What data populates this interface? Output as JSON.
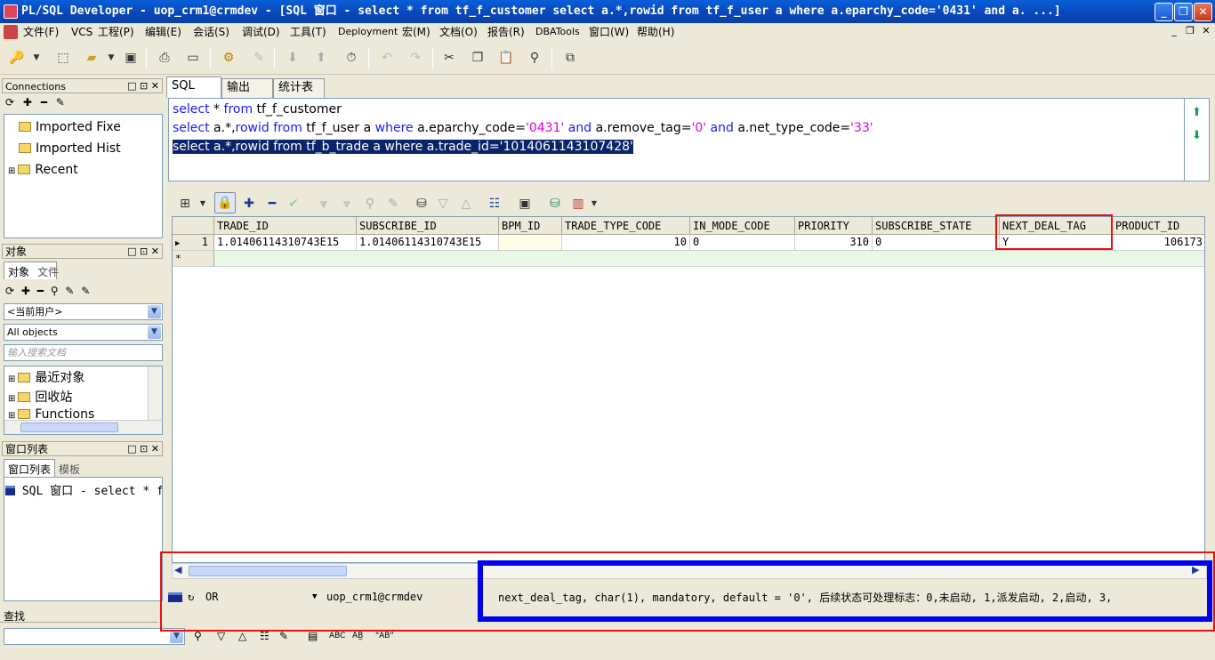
{
  "window": {
    "title": "PL/SQL Developer - uop_crm1@crmdev - [SQL 窗口 - select * from tf_f_customer select a.*,rowid from tf_f_user a where a.eparchy_code='0431' and a. ...]",
    "min": "_",
    "max": "❐",
    "close": "✕"
  },
  "menu": {
    "items": [
      "文件(F)",
      "VCS",
      "工程(P)",
      "编辑(E)",
      "会话(S)",
      "调试(D)",
      "工具(T)",
      "Deployment",
      "宏(M)",
      "文档(O)",
      "报告(R)",
      "DBATools",
      "窗口(W)",
      "帮助(H)"
    ],
    "mdi": [
      "_",
      "❐",
      "✕"
    ]
  },
  "connections": {
    "title": "Connections",
    "toolbar": "⟳ ✚ ━ ✎",
    "items": [
      "Imported Fixe",
      "Imported Hist",
      "Recent"
    ]
  },
  "objects": {
    "title": "对象",
    "tabs": [
      "对象",
      "文件"
    ],
    "toolbar": "⟳ ✚ ━ ⚲ ✎ ✎",
    "user_combo": "<当前用户>",
    "type_combo": "All objects",
    "search_placeholder": "输入搜索文档",
    "tree": [
      "最近对象",
      "回收站",
      "Functions"
    ]
  },
  "windowlist": {
    "title": "窗口列表",
    "tabs": [
      "窗口列表",
      "模板"
    ],
    "item": "SQL 窗口 - select * f"
  },
  "editor": {
    "tabs": [
      "SQL",
      "输出",
      "统计表"
    ],
    "lines": [
      [
        {
          "t": "select",
          "c": "kw"
        },
        {
          "t": " * ",
          "c": ""
        },
        {
          "t": "from",
          "c": "kw"
        },
        {
          "t": " tf_f_customer",
          "c": ""
        }
      ],
      [
        {
          "t": "select",
          "c": "kw"
        },
        {
          "t": " a.*,",
          "c": ""
        },
        {
          "t": "rowid",
          "c": "kw"
        },
        {
          "t": " ",
          "c": ""
        },
        {
          "t": "from",
          "c": "kw"
        },
        {
          "t": " tf_f_user a ",
          "c": ""
        },
        {
          "t": "where",
          "c": "kw"
        },
        {
          "t": " a.eparchy_code=",
          "c": ""
        },
        {
          "t": "'0431'",
          "c": "str"
        },
        {
          "t": " ",
          "c": ""
        },
        {
          "t": "and",
          "c": "kw"
        },
        {
          "t": " a.remove_tag=",
          "c": ""
        },
        {
          "t": "'0'",
          "c": "str"
        },
        {
          "t": " ",
          "c": ""
        },
        {
          "t": "and",
          "c": "kw"
        },
        {
          "t": " a.net_type_code=",
          "c": ""
        },
        {
          "t": "'33'",
          "c": "str"
        }
      ],
      [
        {
          "t": "select a.*,rowid from tf_b_trade a where a.trade_id='1014061143107428'",
          "c": "sel"
        }
      ]
    ]
  },
  "grid": {
    "columns": [
      "TRADE_ID",
      "SUBSCRIBE_ID",
      "BPM_ID",
      "TRADE_TYPE_CODE",
      "IN_MODE_CODE",
      "PRIORITY",
      "SUBSCRIBE_STATE",
      "NEXT_DEAL_TAG",
      "PRODUCT_ID"
    ],
    "rows": [
      {
        "num": "1",
        "cells": [
          "1.01406114310743E15",
          "1.01406114310743E15",
          "",
          "10",
          "0",
          "310",
          "0",
          "Y",
          "106173"
        ]
      }
    ],
    "new_row_marker": "*"
  },
  "status": {
    "mode": "OR",
    "connection": "uop_crm1@crmdev",
    "message": "next_deal_tag, char(1), mandatory, default = '0', 后续状态可处理标志：0,未启动, 1,派发启动, 2,启动, 3,"
  },
  "find": {
    "title": "查找",
    "value": "",
    "toolbar": [
      "⚲",
      "▽",
      "△",
      "☷",
      "✎",
      "▤",
      "ABC",
      "AB̲",
      "\"AB\""
    ]
  }
}
